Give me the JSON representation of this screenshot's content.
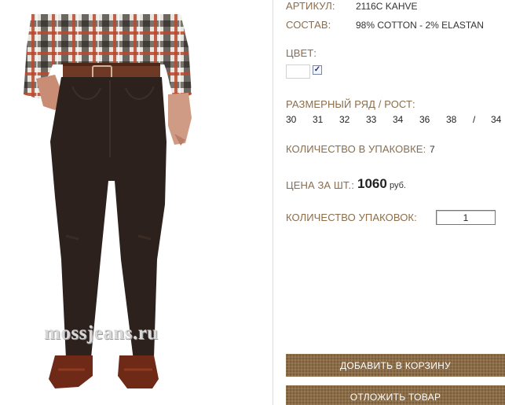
{
  "product": {
    "watermark": "mossjeans.ru",
    "article_label": "АРТИКУЛ:",
    "article_value": "2116C KAHVE",
    "composition_label": "СОСТАВ:",
    "composition_value": "98% COTTON - 2% ELASTAN",
    "color_label": "ЦВЕТ:",
    "color_swatch": "#ffffff",
    "color_selected": true,
    "sizes_label": "РАЗМЕРНЫЙ РЯД / РОСТ:",
    "sizes": [
      "30",
      "31",
      "32",
      "33",
      "34",
      "36",
      "38",
      "/",
      "34"
    ],
    "pack_qty_label": "КОЛИЧЕСТВО В УПАКОВКЕ:",
    "pack_qty_value": "7",
    "price_label": "ЦЕНА ЗА ШТ.:",
    "price_value": "1060",
    "price_currency": "руб.",
    "packs_label": "КОЛИЧЕСТВО УПАКОВОК:",
    "packs_value": "1"
  },
  "actions": {
    "add_to_cart": "ДОБАВИТЬ В КОРЗИНУ",
    "postpone": "ОТЛОЖИТЬ ТОВАР"
  },
  "colors": {
    "label_brown": "#8a6d4b",
    "button_brown": "#8b6c46"
  }
}
